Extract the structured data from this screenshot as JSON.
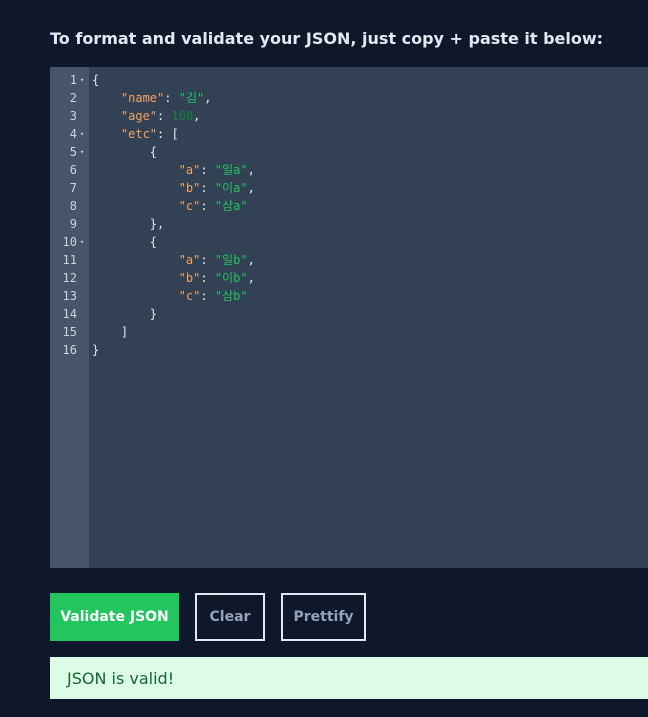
{
  "instructions": "To format and validate your JSON, just copy + paste it below:",
  "editor": {
    "lines": [
      {
        "number": "1",
        "fold": true,
        "tokens": [
          {
            "t": "pun",
            "v": "{"
          }
        ]
      },
      {
        "number": "2",
        "fold": false,
        "tokens": [
          {
            "t": "pun",
            "v": "    "
          },
          {
            "t": "key",
            "v": "\"name\""
          },
          {
            "t": "pun",
            "v": ": "
          },
          {
            "t": "str",
            "v": "\"김\""
          },
          {
            "t": "pun",
            "v": ","
          }
        ]
      },
      {
        "number": "3",
        "fold": false,
        "tokens": [
          {
            "t": "pun",
            "v": "    "
          },
          {
            "t": "key",
            "v": "\"age\""
          },
          {
            "t": "pun",
            "v": ": "
          },
          {
            "t": "num",
            "v": "100"
          },
          {
            "t": "pun",
            "v": ","
          }
        ]
      },
      {
        "number": "4",
        "fold": true,
        "tokens": [
          {
            "t": "pun",
            "v": "    "
          },
          {
            "t": "key",
            "v": "\"etc\""
          },
          {
            "t": "pun",
            "v": ": ["
          }
        ]
      },
      {
        "number": "5",
        "fold": true,
        "tokens": [
          {
            "t": "pun",
            "v": "        {"
          }
        ]
      },
      {
        "number": "6",
        "fold": false,
        "tokens": [
          {
            "t": "pun",
            "v": "            "
          },
          {
            "t": "key",
            "v": "\"a\""
          },
          {
            "t": "pun",
            "v": ": "
          },
          {
            "t": "str",
            "v": "\"일a\""
          },
          {
            "t": "pun",
            "v": ","
          }
        ]
      },
      {
        "number": "7",
        "fold": false,
        "tokens": [
          {
            "t": "pun",
            "v": "            "
          },
          {
            "t": "key",
            "v": "\"b\""
          },
          {
            "t": "pun",
            "v": ": "
          },
          {
            "t": "str",
            "v": "\"이a\""
          },
          {
            "t": "pun",
            "v": ","
          }
        ]
      },
      {
        "number": "8",
        "fold": false,
        "tokens": [
          {
            "t": "pun",
            "v": "            "
          },
          {
            "t": "key",
            "v": "\"c\""
          },
          {
            "t": "pun",
            "v": ": "
          },
          {
            "t": "str",
            "v": "\"삼a\""
          }
        ]
      },
      {
        "number": "9",
        "fold": false,
        "tokens": [
          {
            "t": "pun",
            "v": "        },"
          }
        ]
      },
      {
        "number": "10",
        "fold": true,
        "tokens": [
          {
            "t": "pun",
            "v": "        {"
          }
        ]
      },
      {
        "number": "11",
        "fold": false,
        "tokens": [
          {
            "t": "pun",
            "v": "            "
          },
          {
            "t": "key",
            "v": "\"a\""
          },
          {
            "t": "pun",
            "v": ": "
          },
          {
            "t": "str",
            "v": "\"일b\""
          },
          {
            "t": "pun",
            "v": ","
          }
        ]
      },
      {
        "number": "12",
        "fold": false,
        "tokens": [
          {
            "t": "pun",
            "v": "            "
          },
          {
            "t": "key",
            "v": "\"b\""
          },
          {
            "t": "pun",
            "v": ": "
          },
          {
            "t": "str",
            "v": "\"이b\""
          },
          {
            "t": "pun",
            "v": ","
          }
        ]
      },
      {
        "number": "13",
        "fold": false,
        "tokens": [
          {
            "t": "pun",
            "v": "            "
          },
          {
            "t": "key",
            "v": "\"c\""
          },
          {
            "t": "pun",
            "v": ": "
          },
          {
            "t": "str",
            "v": "\"삼b\""
          }
        ]
      },
      {
        "number": "14",
        "fold": false,
        "tokens": [
          {
            "t": "pun",
            "v": "        }"
          }
        ]
      },
      {
        "number": "15",
        "fold": false,
        "tokens": [
          {
            "t": "pun",
            "v": "    ]"
          }
        ]
      },
      {
        "number": "16",
        "fold": false,
        "tokens": [
          {
            "t": "pun",
            "v": "}"
          }
        ]
      }
    ]
  },
  "buttons": {
    "validate": "Validate JSON",
    "clear": "Clear",
    "prettify": "Prettify"
  },
  "result": {
    "message": "JSON is valid!"
  },
  "colors": {
    "background": "#0f172a",
    "editor_bg": "#334155",
    "gutter_bg": "#475569",
    "key": "#f4a261",
    "string": "#22c55e",
    "number": "#15803d",
    "validate_button": "#22c55e",
    "result_bg": "#dcfce7",
    "result_text": "#166534"
  }
}
